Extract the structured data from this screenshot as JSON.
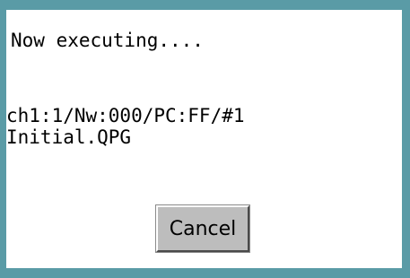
{
  "dialog": {
    "message": "Now executing....",
    "connection": "ch1:1/Nw:000/PC:FF/#1",
    "file_name": "Initial.QPG",
    "cancel_label": "Cancel"
  },
  "colors": {
    "frame": "#5a9ba6",
    "background": "#ffffff",
    "button": "#bdbdbd"
  }
}
